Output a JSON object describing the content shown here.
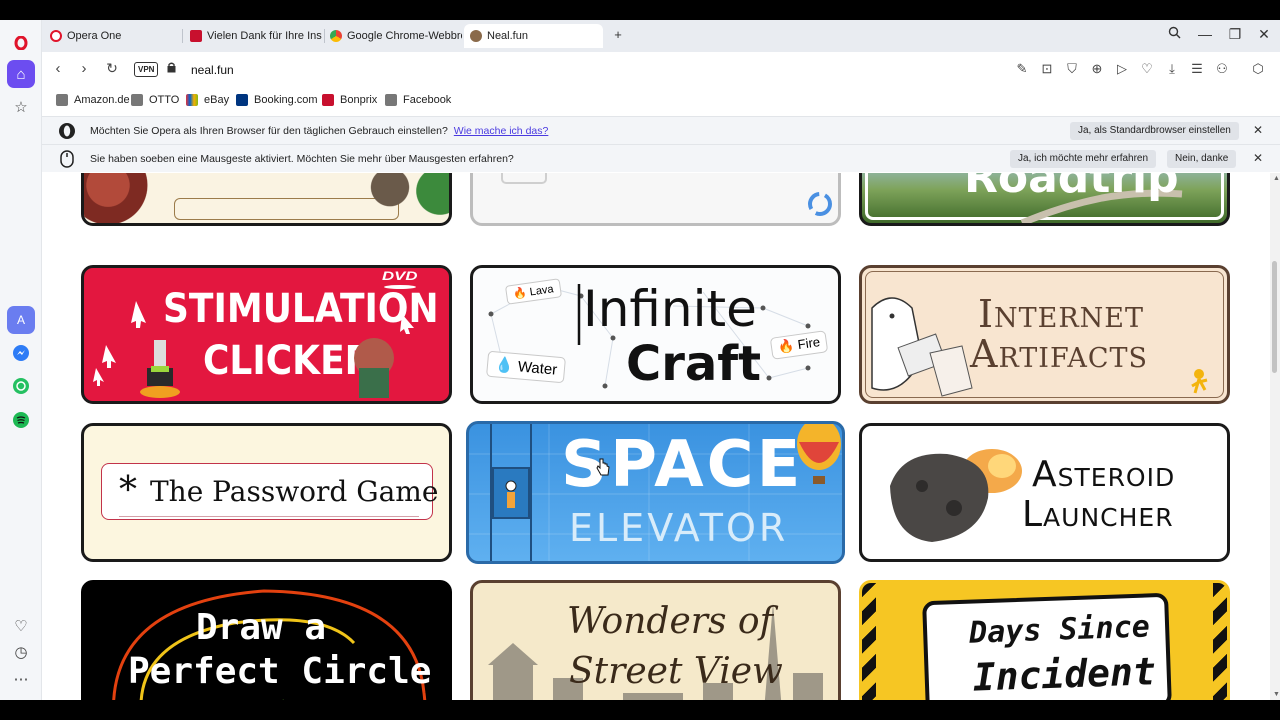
{
  "tabs": [
    {
      "title": "Opera One"
    },
    {
      "title": "Vielen Dank für Ihre Instal"
    },
    {
      "title": "Google Chrome-Webbrow"
    },
    {
      "title": "Neal.fun"
    }
  ],
  "address": {
    "vpn": "VPN",
    "url": "neal.fun"
  },
  "bookmarks": [
    "Amazon.de",
    "OTTO",
    "eBay",
    "Booking.com",
    "Bonprix",
    "Facebook"
  ],
  "infobar1": {
    "text": "Möchten Sie Opera als Ihren Browser für den täglichen Gebrauch einstellen?",
    "link": "Wie mache ich das?",
    "button": "Ja, als Standardbrowser einstellen"
  },
  "infobar2": {
    "text": "Sie haben soeben eine Mausgeste aktiviert. Möchten Sie mehr über Mausgesten erfahren?",
    "button_yes": "Ja, ich möchte mehr erfahren",
    "button_no": "Nein, danke"
  },
  "cards": {
    "roadtrip": "Roadtrip",
    "dvd": "DVD",
    "stim1": "STIMULATION",
    "stim2": "CLICKER",
    "infinite1": "Infinite",
    "infinite2": "Craft",
    "lava": "Lava",
    "water": "Water",
    "fire": "Fire",
    "internet1": "Internet",
    "internet2": "Artifacts",
    "password": "The Password Game",
    "space1": "SPACE",
    "space2": "ELEVATOR",
    "asteroid1": "Asteroid",
    "asteroid2": "Launcher",
    "draw1": "Draw a",
    "draw2": "Perfect Circle",
    "wonders1": "Wonders of",
    "wonders2": "Street View",
    "days1": "Days Since",
    "days2": "Incident"
  },
  "icons": {
    "sidebar": [
      "opera-logo-icon",
      "home-icon",
      "star-icon",
      "aria-icon",
      "messenger-icon",
      "whatsapp-icon",
      "spotify-icon",
      "heart-icon",
      "history-icon",
      "more-icon"
    ]
  }
}
